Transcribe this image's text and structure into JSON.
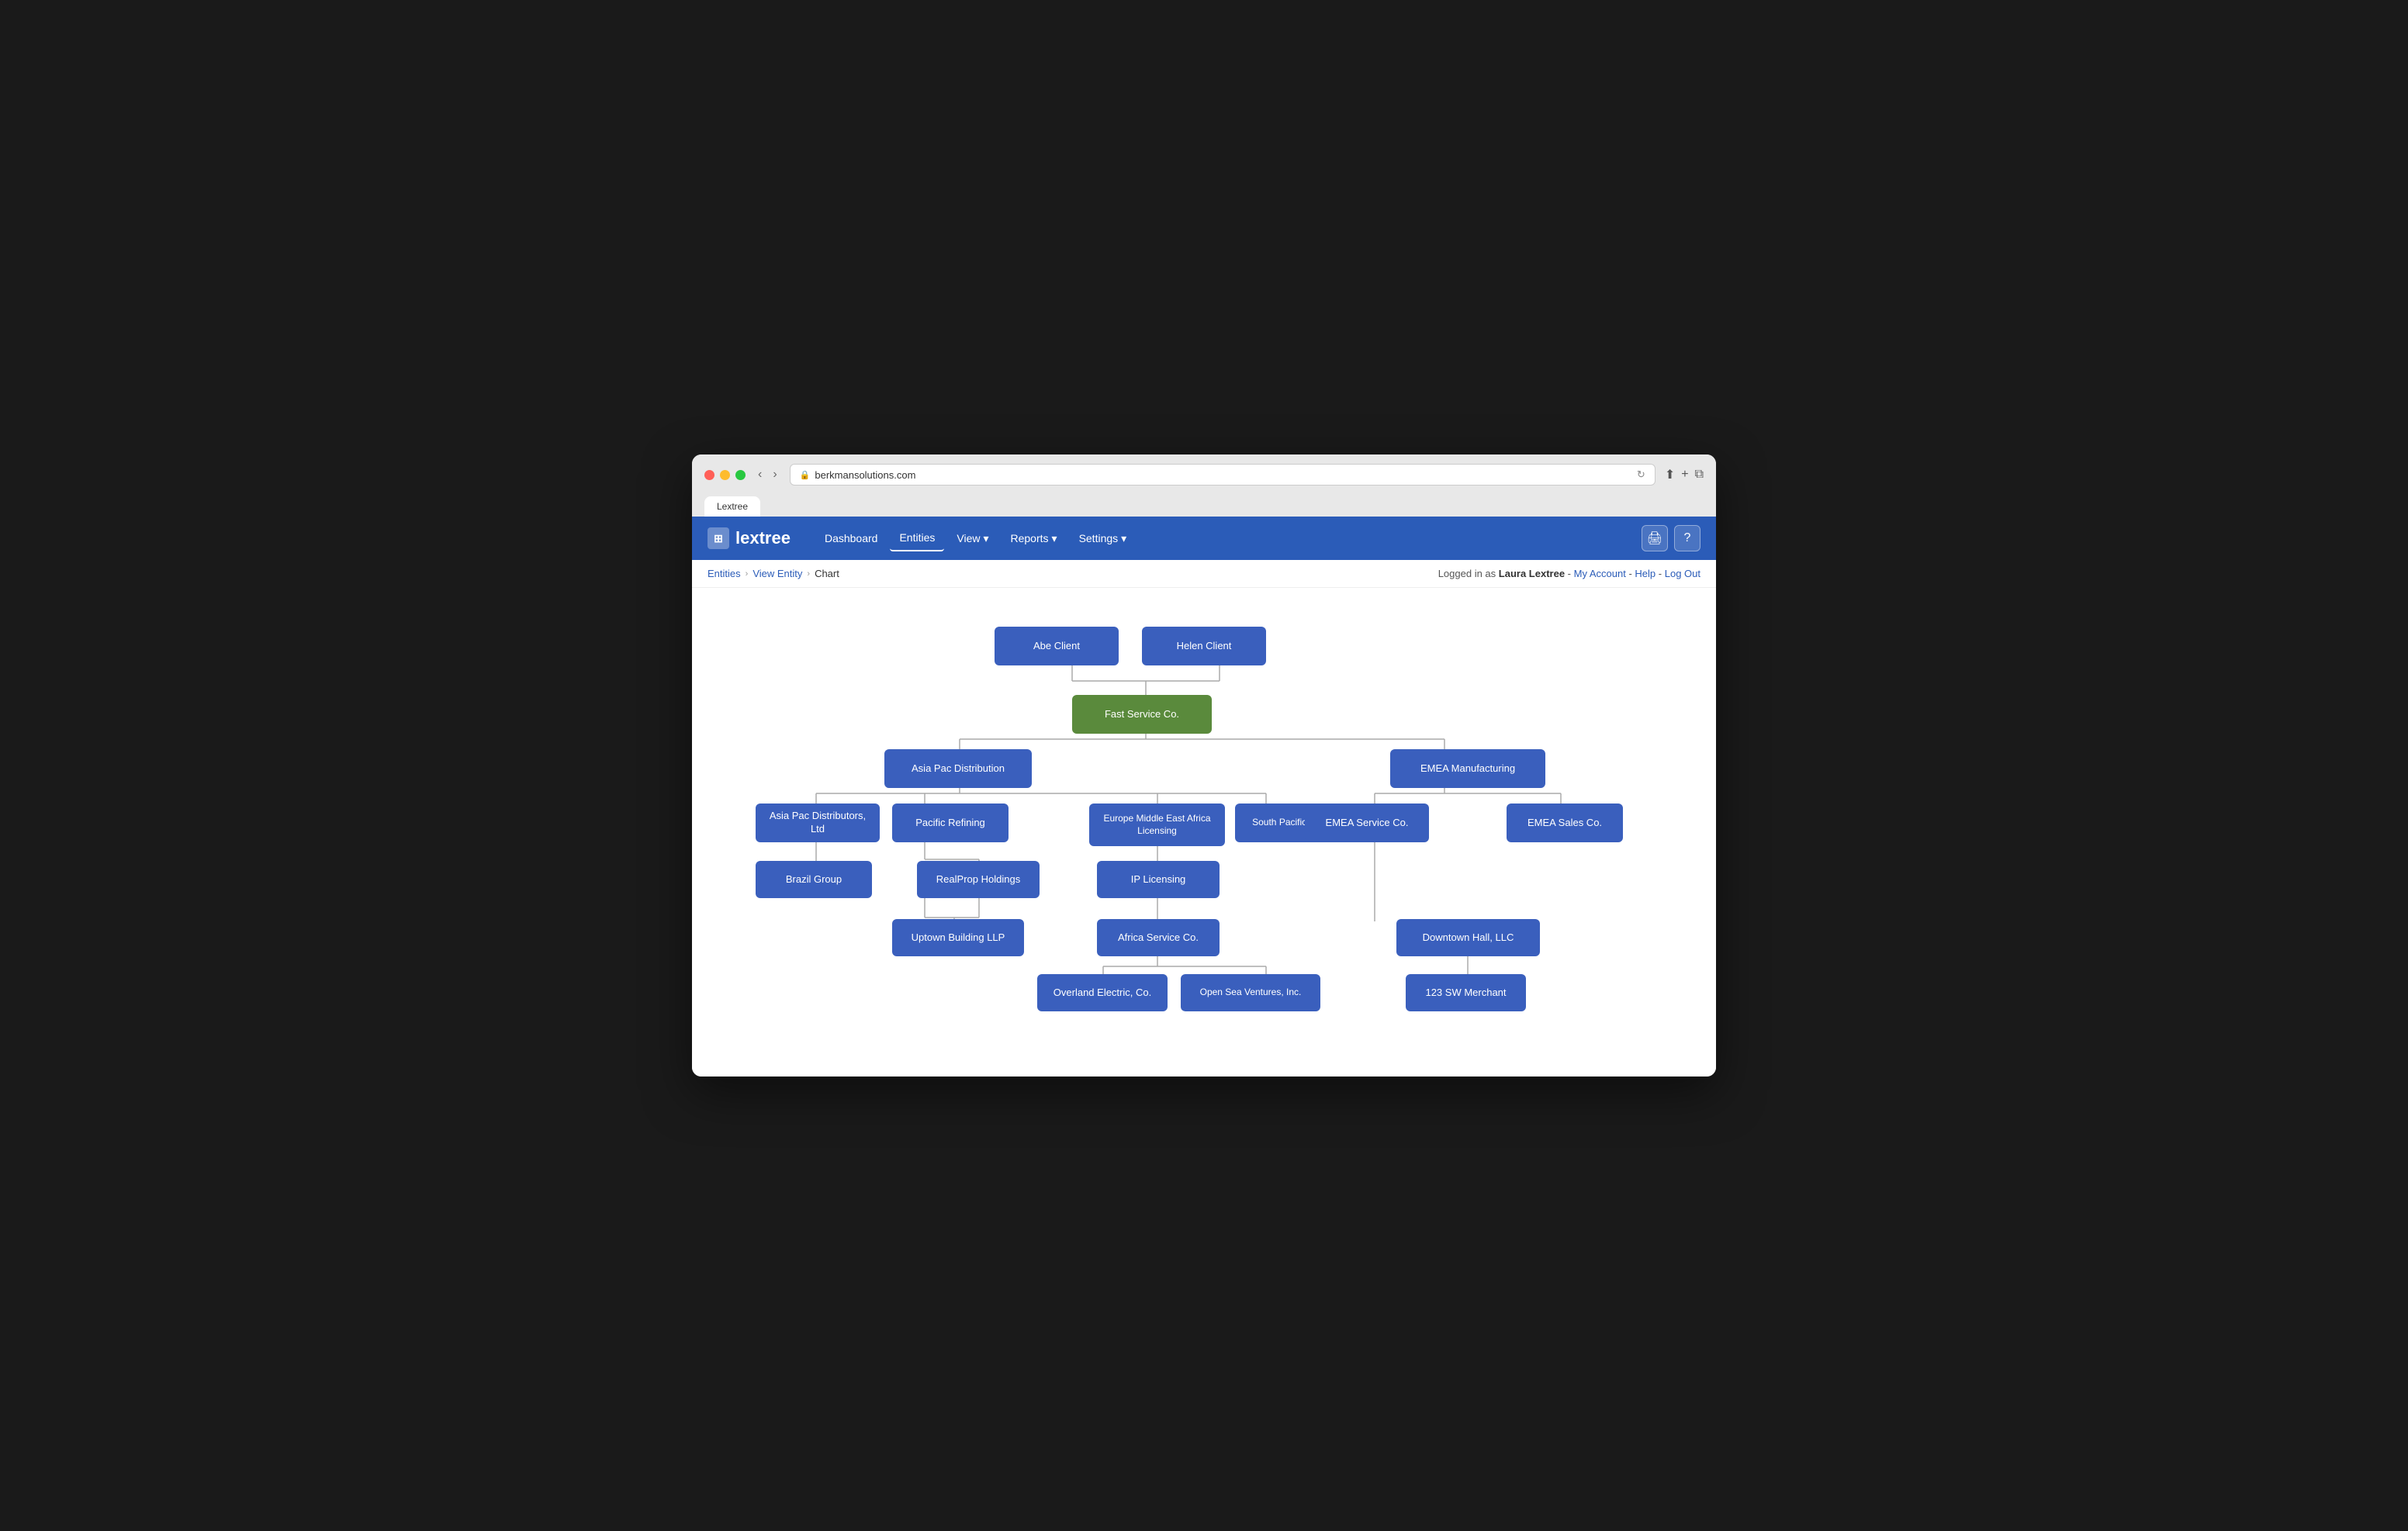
{
  "browser": {
    "url": "berkmansolutions.com",
    "tab_title": "Lextree"
  },
  "app": {
    "logo_text": "lextree",
    "nav": {
      "items": [
        {
          "label": "Dashboard",
          "active": false
        },
        {
          "label": "Entities",
          "active": true
        },
        {
          "label": "View",
          "active": false,
          "has_arrow": true
        },
        {
          "label": "Reports",
          "active": false,
          "has_arrow": true
        },
        {
          "label": "Settings",
          "active": false,
          "has_arrow": true
        }
      ]
    },
    "header_buttons": [
      "🖨",
      "?"
    ]
  },
  "breadcrumb": {
    "items": [
      "Entities",
      "View Entity",
      "Chart"
    ],
    "user_text": "Logged in as ",
    "user_name": "Laura Lextree",
    "links": [
      "My Account",
      "Help",
      "Log Out"
    ]
  },
  "chart": {
    "nodes": [
      {
        "id": "abe",
        "label": "Abe Client",
        "type": "blue"
      },
      {
        "id": "helen",
        "label": "Helen Client",
        "type": "blue"
      },
      {
        "id": "fast",
        "label": "Fast Service Co.",
        "type": "green"
      },
      {
        "id": "asia_pac",
        "label": "Asia Pac Distribution",
        "type": "blue"
      },
      {
        "id": "emea_mfg",
        "label": "EMEA Manufacturing",
        "type": "blue"
      },
      {
        "id": "asia_pac_dist",
        "label": "Asia Pac Distributors, Ltd",
        "type": "blue"
      },
      {
        "id": "pacific",
        "label": "Pacific Refining",
        "type": "blue"
      },
      {
        "id": "emea_lic",
        "label": "Europe Middle East Africa Licensing",
        "type": "blue"
      },
      {
        "id": "south_pac",
        "label": "South Pacific Metals Co.",
        "type": "blue"
      },
      {
        "id": "emea_svc",
        "label": "EMEA Service Co.",
        "type": "blue"
      },
      {
        "id": "emea_sales",
        "label": "EMEA Sales Co.",
        "type": "blue"
      },
      {
        "id": "brazil",
        "label": "Brazil Group",
        "type": "blue"
      },
      {
        "id": "realprop",
        "label": "RealProp Holdings",
        "type": "blue"
      },
      {
        "id": "ip_lic",
        "label": "IP Licensing",
        "type": "blue"
      },
      {
        "id": "uptown",
        "label": "Uptown Building LLP",
        "type": "blue"
      },
      {
        "id": "africa",
        "label": "Africa Service Co.",
        "type": "blue"
      },
      {
        "id": "downtown",
        "label": "Downtown Hall, LLC",
        "type": "blue"
      },
      {
        "id": "overland",
        "label": "Overland Electric, Co.",
        "type": "blue"
      },
      {
        "id": "open_sea",
        "label": "Open Sea Ventures, Inc.",
        "type": "blue"
      },
      {
        "id": "sw_merchant",
        "label": "123 SW Merchant",
        "type": "blue"
      }
    ]
  }
}
